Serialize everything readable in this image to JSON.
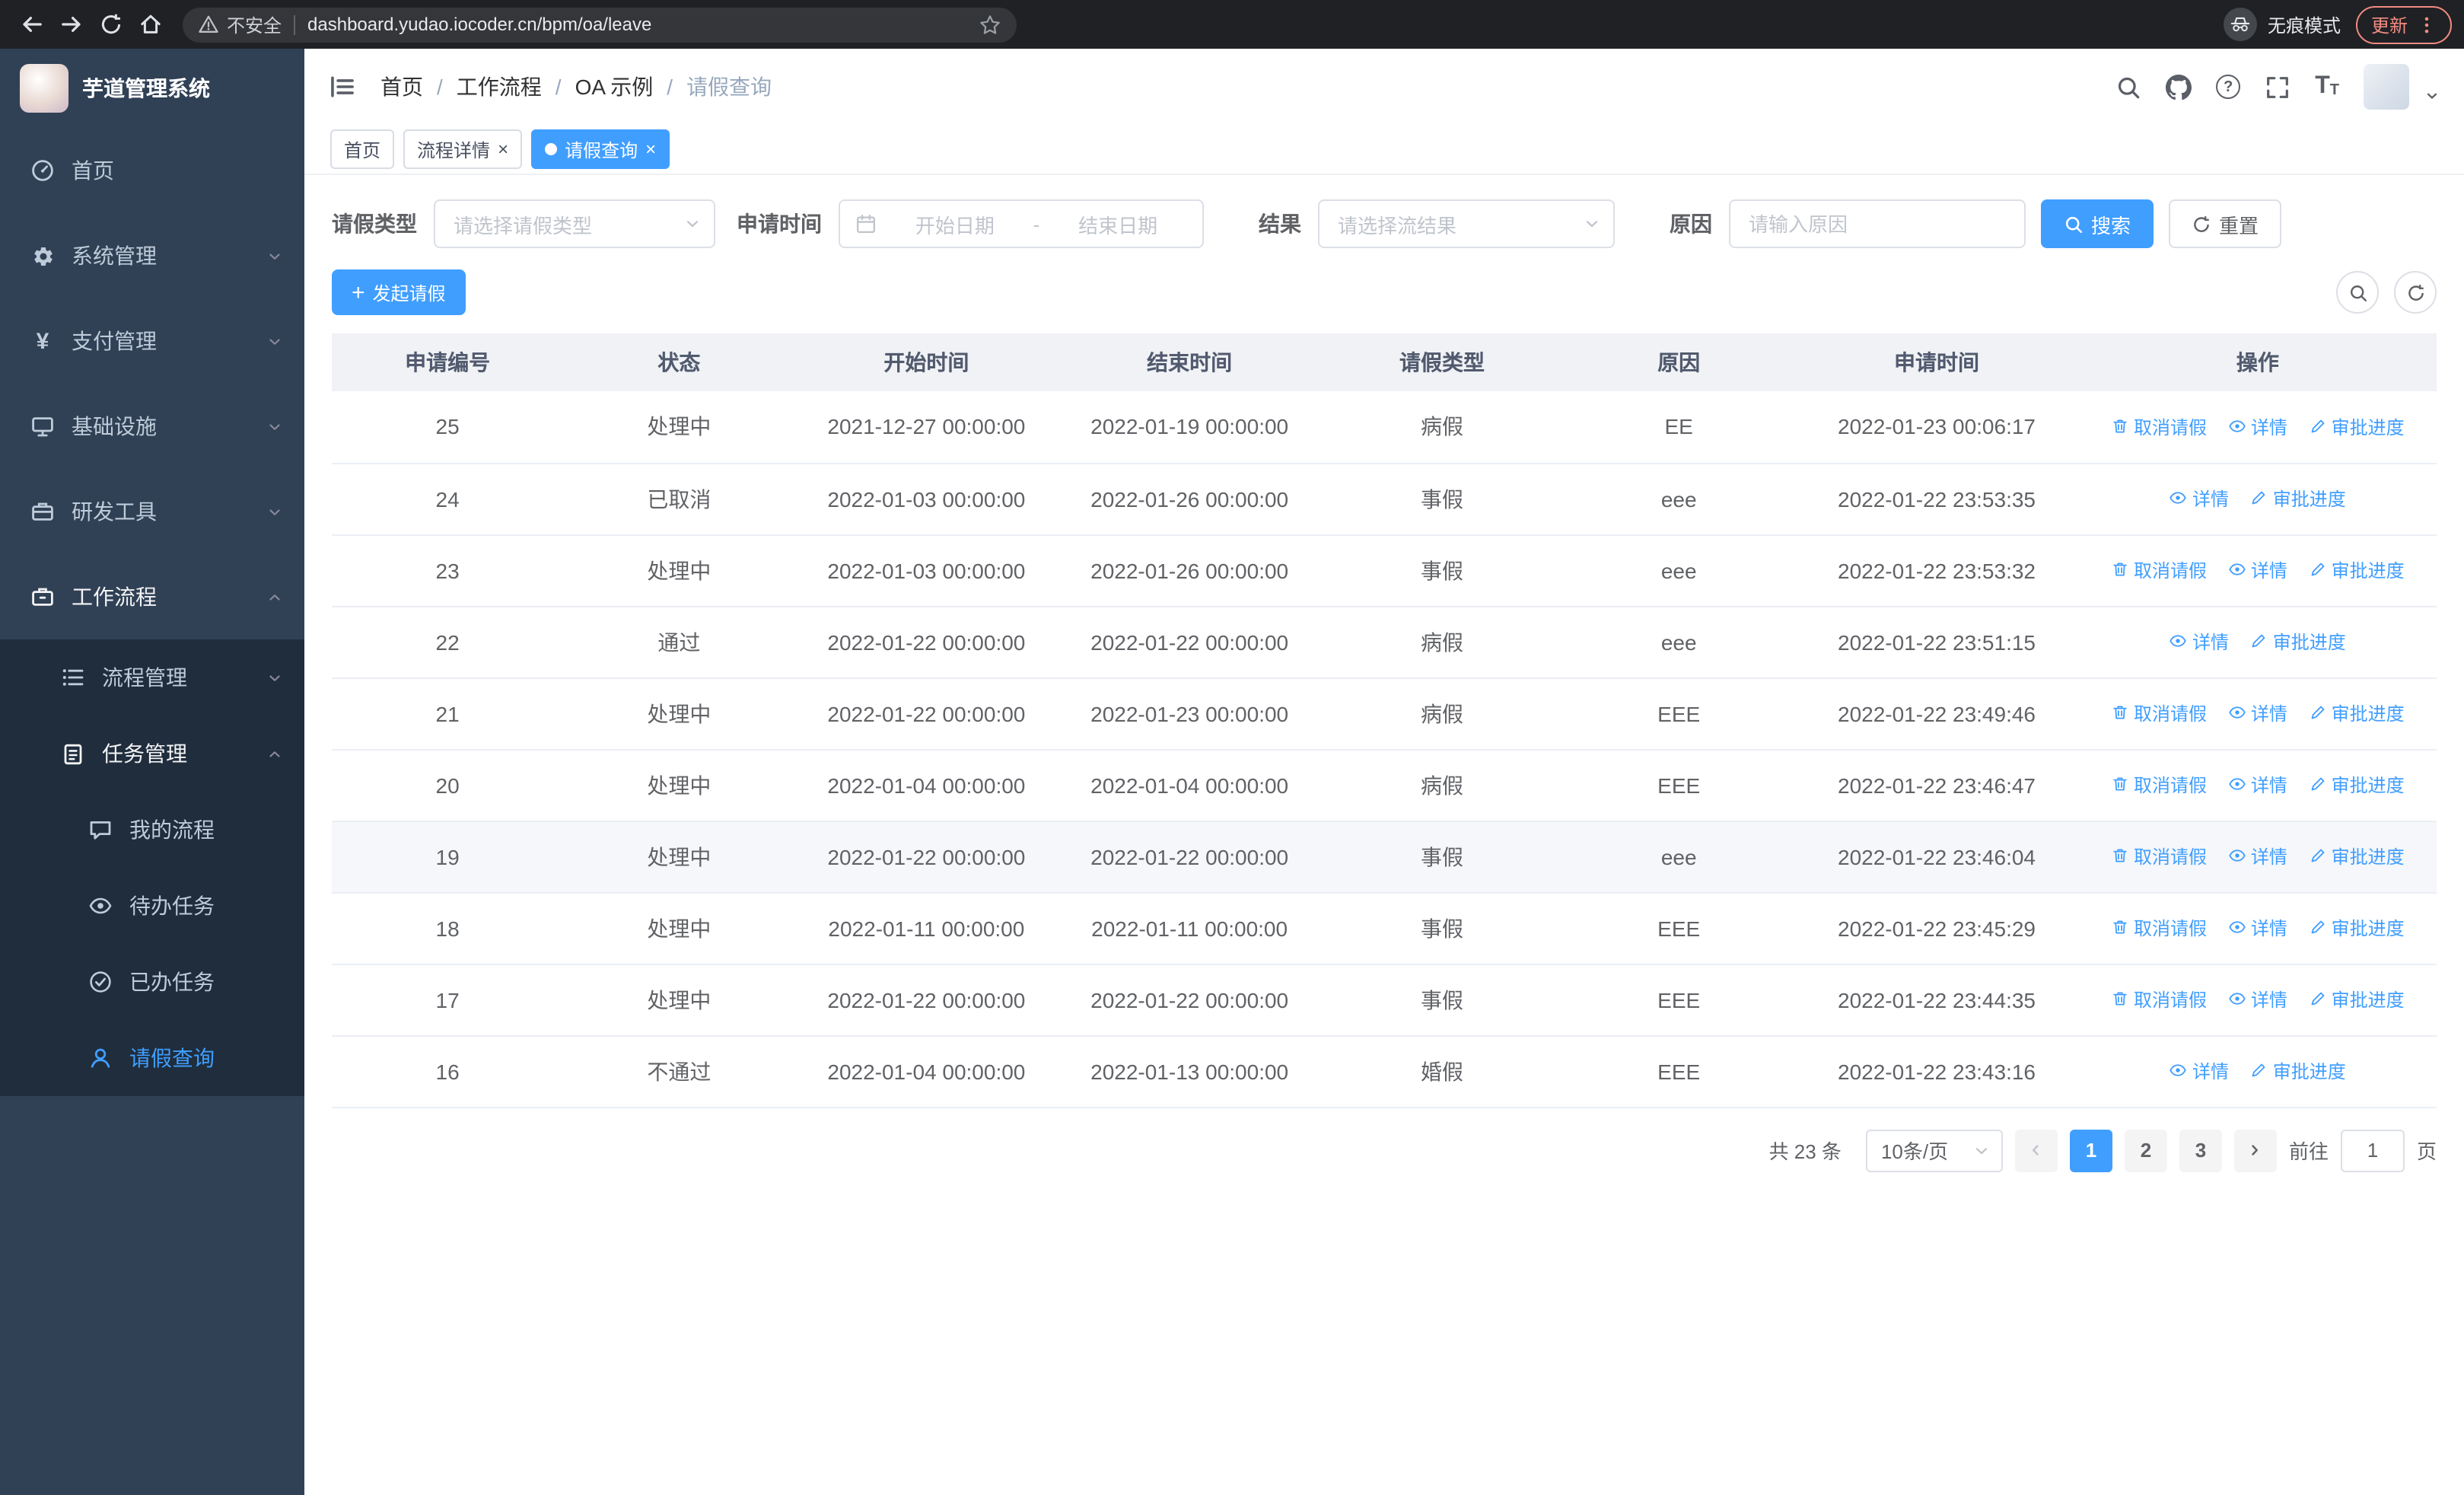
{
  "colors": {
    "accent": "#409eff",
    "sidebar_bg": "#304156",
    "submenu_bg": "#1f2d3d",
    "chrome_bg": "#202124"
  },
  "browser": {
    "security_label": "不安全",
    "url": "dashboard.yudao.iocoder.cn/bpm/oa/leave",
    "incognito_label": "无痕模式",
    "update_label": "更新"
  },
  "sidebar": {
    "logo_title": "芋道管理系统",
    "items": [
      {
        "label": "首页"
      },
      {
        "label": "系统管理"
      },
      {
        "label": "支付管理"
      },
      {
        "label": "基础设施"
      },
      {
        "label": "研发工具"
      },
      {
        "label": "工作流程"
      }
    ],
    "sub": [
      {
        "label": "流程管理"
      },
      {
        "label": "任务管理"
      }
    ],
    "leaf": [
      {
        "label": "我的流程"
      },
      {
        "label": "待办任务"
      },
      {
        "label": "已办任务"
      },
      {
        "label": "请假查询"
      }
    ]
  },
  "header": {
    "breadcrumb": [
      "首页",
      "工作流程",
      "OA 示例",
      "请假查询"
    ]
  },
  "tabs": [
    {
      "label": "首页"
    },
    {
      "label": "流程详情"
    },
    {
      "label": "请假查询"
    }
  ],
  "filters": {
    "leave_type_label": "请假类型",
    "leave_type_placeholder": "请选择请假类型",
    "apply_time_label": "申请时间",
    "start_date_placeholder": "开始日期",
    "range_separator": "-",
    "end_date_placeholder": "结束日期",
    "result_label": "结果",
    "result_placeholder": "请选择流结果",
    "reason_label": "原因",
    "reason_placeholder": "请输入原因",
    "search_label": "搜索",
    "reset_label": "重置"
  },
  "toolbar": {
    "create_label": "发起请假"
  },
  "table": {
    "headers": [
      "申请编号",
      "状态",
      "开始时间",
      "结束时间",
      "请假类型",
      "原因",
      "申请时间",
      "操作"
    ],
    "actions": {
      "cancel": "取消请假",
      "detail": "详情",
      "progress": "审批进度"
    },
    "rows": [
      {
        "id": "25",
        "status": "处理中",
        "start": "2021-12-27 00:00:00",
        "end": "2022-01-19 00:00:00",
        "type": "病假",
        "reason": "EE",
        "apply": "2022-01-23 00:06:17",
        "cancellable": true,
        "hover": false
      },
      {
        "id": "24",
        "status": "已取消",
        "start": "2022-01-03 00:00:00",
        "end": "2022-01-26 00:00:00",
        "type": "事假",
        "reason": "eee",
        "apply": "2022-01-22 23:53:35",
        "cancellable": false,
        "hover": false
      },
      {
        "id": "23",
        "status": "处理中",
        "start": "2022-01-03 00:00:00",
        "end": "2022-01-26 00:00:00",
        "type": "事假",
        "reason": "eee",
        "apply": "2022-01-22 23:53:32",
        "cancellable": true,
        "hover": false
      },
      {
        "id": "22",
        "status": "通过",
        "start": "2022-01-22 00:00:00",
        "end": "2022-01-22 00:00:00",
        "type": "病假",
        "reason": "eee",
        "apply": "2022-01-22 23:51:15",
        "cancellable": false,
        "hover": false
      },
      {
        "id": "21",
        "status": "处理中",
        "start": "2022-01-22 00:00:00",
        "end": "2022-01-23 00:00:00",
        "type": "病假",
        "reason": "EEE",
        "apply": "2022-01-22 23:49:46",
        "cancellable": true,
        "hover": false
      },
      {
        "id": "20",
        "status": "处理中",
        "start": "2022-01-04 00:00:00",
        "end": "2022-01-04 00:00:00",
        "type": "病假",
        "reason": "EEE",
        "apply": "2022-01-22 23:46:47",
        "cancellable": true,
        "hover": false
      },
      {
        "id": "19",
        "status": "处理中",
        "start": "2022-01-22 00:00:00",
        "end": "2022-01-22 00:00:00",
        "type": "事假",
        "reason": "eee",
        "apply": "2022-01-22 23:46:04",
        "cancellable": true,
        "hover": true
      },
      {
        "id": "18",
        "status": "处理中",
        "start": "2022-01-11 00:00:00",
        "end": "2022-01-11 00:00:00",
        "type": "事假",
        "reason": "EEE",
        "apply": "2022-01-22 23:45:29",
        "cancellable": true,
        "hover": false
      },
      {
        "id": "17",
        "status": "处理中",
        "start": "2022-01-22 00:00:00",
        "end": "2022-01-22 00:00:00",
        "type": "事假",
        "reason": "EEE",
        "apply": "2022-01-22 23:44:35",
        "cancellable": true,
        "hover": false
      },
      {
        "id": "16",
        "status": "不通过",
        "start": "2022-01-04 00:00:00",
        "end": "2022-01-13 00:00:00",
        "type": "婚假",
        "reason": "EEE",
        "apply": "2022-01-22 23:43:16",
        "cancellable": false,
        "hover": false
      }
    ]
  },
  "pagination": {
    "total_label": "共 23 条",
    "page_size": "10条/页",
    "pages": [
      "1",
      "2",
      "3"
    ],
    "active_page": "1",
    "goto_label": "前往",
    "goto_value": "1",
    "unit_label": "页"
  }
}
